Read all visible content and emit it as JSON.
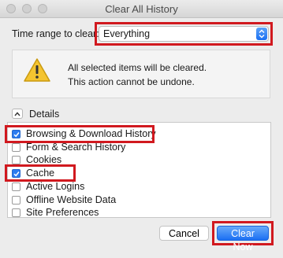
{
  "window": {
    "title": "Clear All History"
  },
  "time_range": {
    "label": "Time range to clear:",
    "selected": "Everything"
  },
  "warning": {
    "line1": "All selected items will be cleared.",
    "line2": "This action cannot be undone."
  },
  "details": {
    "label": "Details",
    "expanded": true
  },
  "items": [
    {
      "label": "Browsing & Download History",
      "checked": true
    },
    {
      "label": "Form & Search History",
      "checked": false
    },
    {
      "label": "Cookies",
      "checked": false
    },
    {
      "label": "Cache",
      "checked": true
    },
    {
      "label": "Active Logins",
      "checked": false
    },
    {
      "label": "Offline Website Data",
      "checked": false
    },
    {
      "label": "Site Preferences",
      "checked": false
    }
  ],
  "buttons": {
    "cancel": "Cancel",
    "clear": "Clear Now"
  },
  "colors": {
    "highlight": "#d1191f",
    "accent": "#1b6ff3"
  }
}
